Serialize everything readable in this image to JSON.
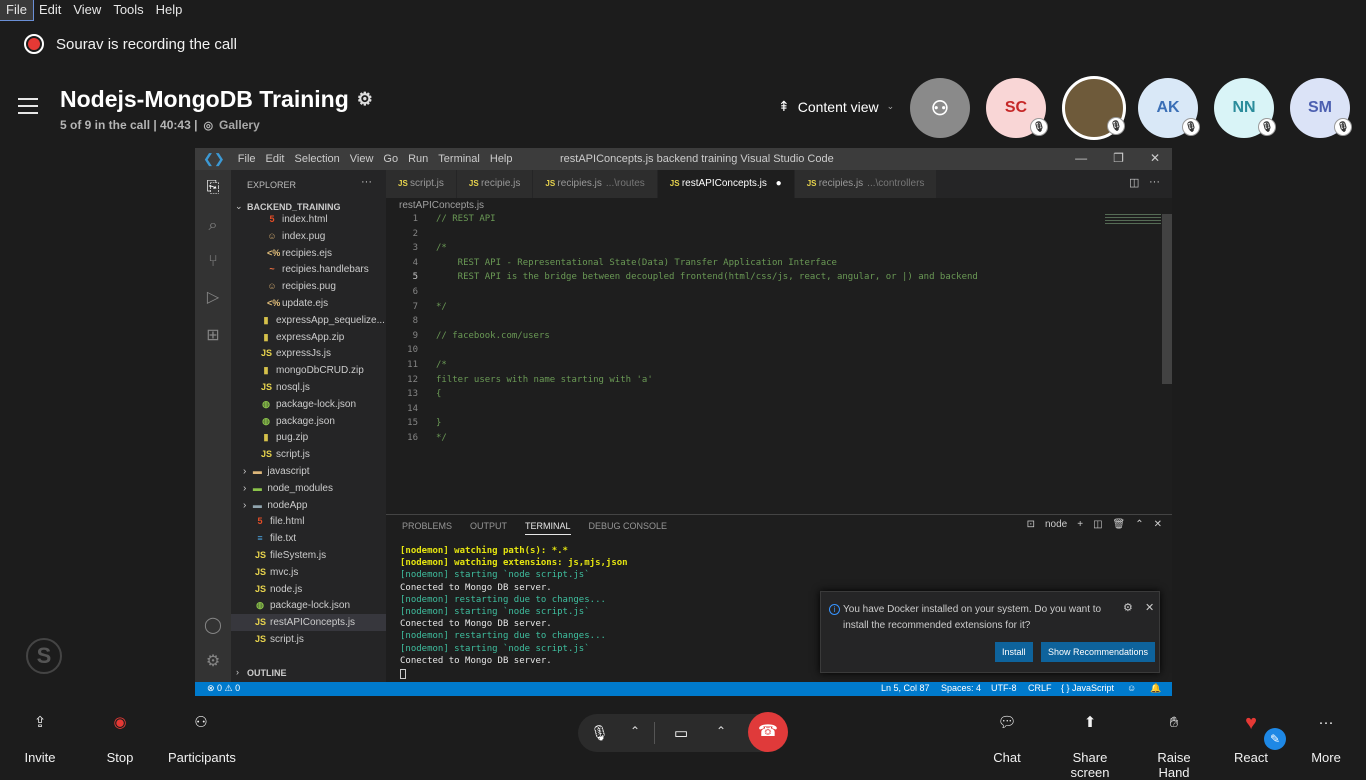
{
  "menu": [
    "File",
    "Edit",
    "View",
    "Tools",
    "Help"
  ],
  "recording_text": "Sourav is recording the call",
  "call": {
    "title": "Nodejs-MongoDB Training",
    "status": "5 of 9 in the call | 40:43 |",
    "view_mode": "Gallery",
    "content_view_label": "Content view"
  },
  "participants": [
    {
      "initials": "SC",
      "bg": "#f9d6d6",
      "fg": "#c62828"
    },
    {
      "initials": "",
      "bg": "#6e5a3a",
      "fg": "#ffffff"
    },
    {
      "initials": "AK",
      "bg": "#d9e8f7",
      "fg": "#3b6fb6"
    },
    {
      "initials": "NN",
      "bg": "#d9f4f7",
      "fg": "#2a8c9b"
    },
    {
      "initials": "SM",
      "bg": "#dbe3f7",
      "fg": "#4c5fb0"
    }
  ],
  "vscode": {
    "menu": [
      "File",
      "Edit",
      "Selection",
      "View",
      "Go",
      "Run",
      "Terminal",
      "Help"
    ],
    "window_title": "restAPIConcepts.js  backend training  Visual Studio Code",
    "explorer_label": "EXPLORER",
    "folder_label": "BACKEND_TRAINING",
    "outline_label": "OUTLINE",
    "files": [
      {
        "name": "index.html",
        "icon": "5",
        "color": "#e44d26",
        "indent": 2
      },
      {
        "name": "index.pug",
        "icon": "☺",
        "color": "#c9a36a",
        "indent": 2
      },
      {
        "name": "recipies.ejs",
        "icon": "<%",
        "color": "#e5c07b",
        "indent": 2
      },
      {
        "name": "recipies.handlebars",
        "icon": "~",
        "color": "#f07040",
        "indent": 2
      },
      {
        "name": "recipies.pug",
        "icon": "☺",
        "color": "#c9a36a",
        "indent": 2
      },
      {
        "name": "update.ejs",
        "icon": "<%",
        "color": "#e5c07b",
        "indent": 2
      },
      {
        "name": "expressApp_sequelize...",
        "icon": "▮",
        "color": "#d6c14a",
        "indent": 1
      },
      {
        "name": "expressApp.zip",
        "icon": "▮",
        "color": "#d6c14a",
        "indent": 1
      },
      {
        "name": "expressJs.js",
        "icon": "JS",
        "color": "#e8d44d",
        "indent": 1
      },
      {
        "name": "mongoDbCRUD.zip",
        "icon": "▮",
        "color": "#d6c14a",
        "indent": 1
      },
      {
        "name": "nosql.js",
        "icon": "JS",
        "color": "#e8d44d",
        "indent": 1
      },
      {
        "name": "package-lock.json",
        "icon": "◍",
        "color": "#8bc34a",
        "indent": 1
      },
      {
        "name": "package.json",
        "icon": "◍",
        "color": "#8bc34a",
        "indent": 1
      },
      {
        "name": "pug.zip",
        "icon": "▮",
        "color": "#d6c14a",
        "indent": 1
      },
      {
        "name": "script.js",
        "icon": "JS",
        "color": "#e8d44d",
        "indent": 1
      },
      {
        "name": "javascript",
        "icon": "▬",
        "color": "#dcb67a",
        "indent": 0,
        "folder": true
      },
      {
        "name": "node_modules",
        "icon": "▬",
        "color": "#8bc34a",
        "indent": 0,
        "folder": true
      },
      {
        "name": "nodeApp",
        "icon": "▬",
        "color": "#90a4ae",
        "indent": 0,
        "folder": true
      },
      {
        "name": "file.html",
        "icon": "5",
        "color": "#e44d26",
        "indent": 0
      },
      {
        "name": "file.txt",
        "icon": "≡",
        "color": "#4aa3df",
        "indent": 0
      },
      {
        "name": "fileSystem.js",
        "icon": "JS",
        "color": "#e8d44d",
        "indent": 0
      },
      {
        "name": "mvc.js",
        "icon": "JS",
        "color": "#e8d44d",
        "indent": 0
      },
      {
        "name": "node.js",
        "icon": "JS",
        "color": "#e8d44d",
        "indent": 0
      },
      {
        "name": "package-lock.json",
        "icon": "◍",
        "color": "#8bc34a",
        "indent": 0
      },
      {
        "name": "restAPIConcepts.js",
        "icon": "JS",
        "color": "#e8d44d",
        "indent": 0,
        "selected": true
      },
      {
        "name": "script.js",
        "icon": "JS",
        "color": "#e8d44d",
        "indent": 0
      }
    ],
    "tabs": [
      {
        "name": "script.js",
        "path": ""
      },
      {
        "name": "recipie.js",
        "path": ""
      },
      {
        "name": "recipies.js",
        "path": "...\\routes"
      },
      {
        "name": "restAPIConcepts.js",
        "path": "",
        "active": true,
        "dirty": true
      },
      {
        "name": "recipies.js",
        "path": "...\\controllers"
      }
    ],
    "breadcrumb": "restAPIConcepts.js",
    "code_lines": [
      "// REST API",
      "",
      "/*",
      "    REST API - Representational State(Data) Transfer Application Interface",
      "    REST API is the bridge between decoupled frontend(html/css/js, react, angular, or |) and backend",
      "",
      "*/",
      "",
      "// facebook.com/users",
      "",
      "/*",
      "filter users with name starting with 'a'",
      "{",
      "",
      "}",
      "*/"
    ],
    "panel_tabs": [
      "PROBLEMS",
      "OUTPUT",
      "TERMINAL",
      "DEBUG CONSOLE"
    ],
    "terminal_shell": "node",
    "terminal_lines": [
      {
        "text": "[nodemon] watching path(s): *.*",
        "style": "y"
      },
      {
        "text": "[nodemon] watching extensions: js,mjs,json",
        "style": "y"
      },
      {
        "text": "[nodemon] starting `node script.js`",
        "style": "g"
      },
      {
        "text": "Conected to Mongo DB server.",
        "style": "w"
      },
      {
        "text": "[nodemon] restarting due to changes...",
        "style": "g"
      },
      {
        "text": "[nodemon] starting `node script.js`",
        "style": "g"
      },
      {
        "text": "Conected to Mongo DB server.",
        "style": "w"
      },
      {
        "text": "[nodemon] restarting due to changes...",
        "style": "g"
      },
      {
        "text": "[nodemon] starting `node script.js`",
        "style": "g"
      },
      {
        "text": "Conected to Mongo DB server.",
        "style": "w"
      }
    ],
    "notification": {
      "message": "You have Docker installed on your system. Do you want to install the recommended extensions for it?",
      "install_label": "Install",
      "recommend_label": "Show Recommendations"
    },
    "status": {
      "problems": "⊗ 0 ⚠ 0",
      "position": "Ln 5, Col 87",
      "spaces": "Spaces: 4",
      "encoding": "UTF-8",
      "eol": "CRLF",
      "language": "{ }  JavaScript"
    }
  },
  "bottom": {
    "invite": "Invite",
    "stop": "Stop",
    "participants": "Participants",
    "chat": "Chat",
    "share": "Share screen",
    "raise": "Raise Hand",
    "react": "React",
    "more": "More"
  }
}
